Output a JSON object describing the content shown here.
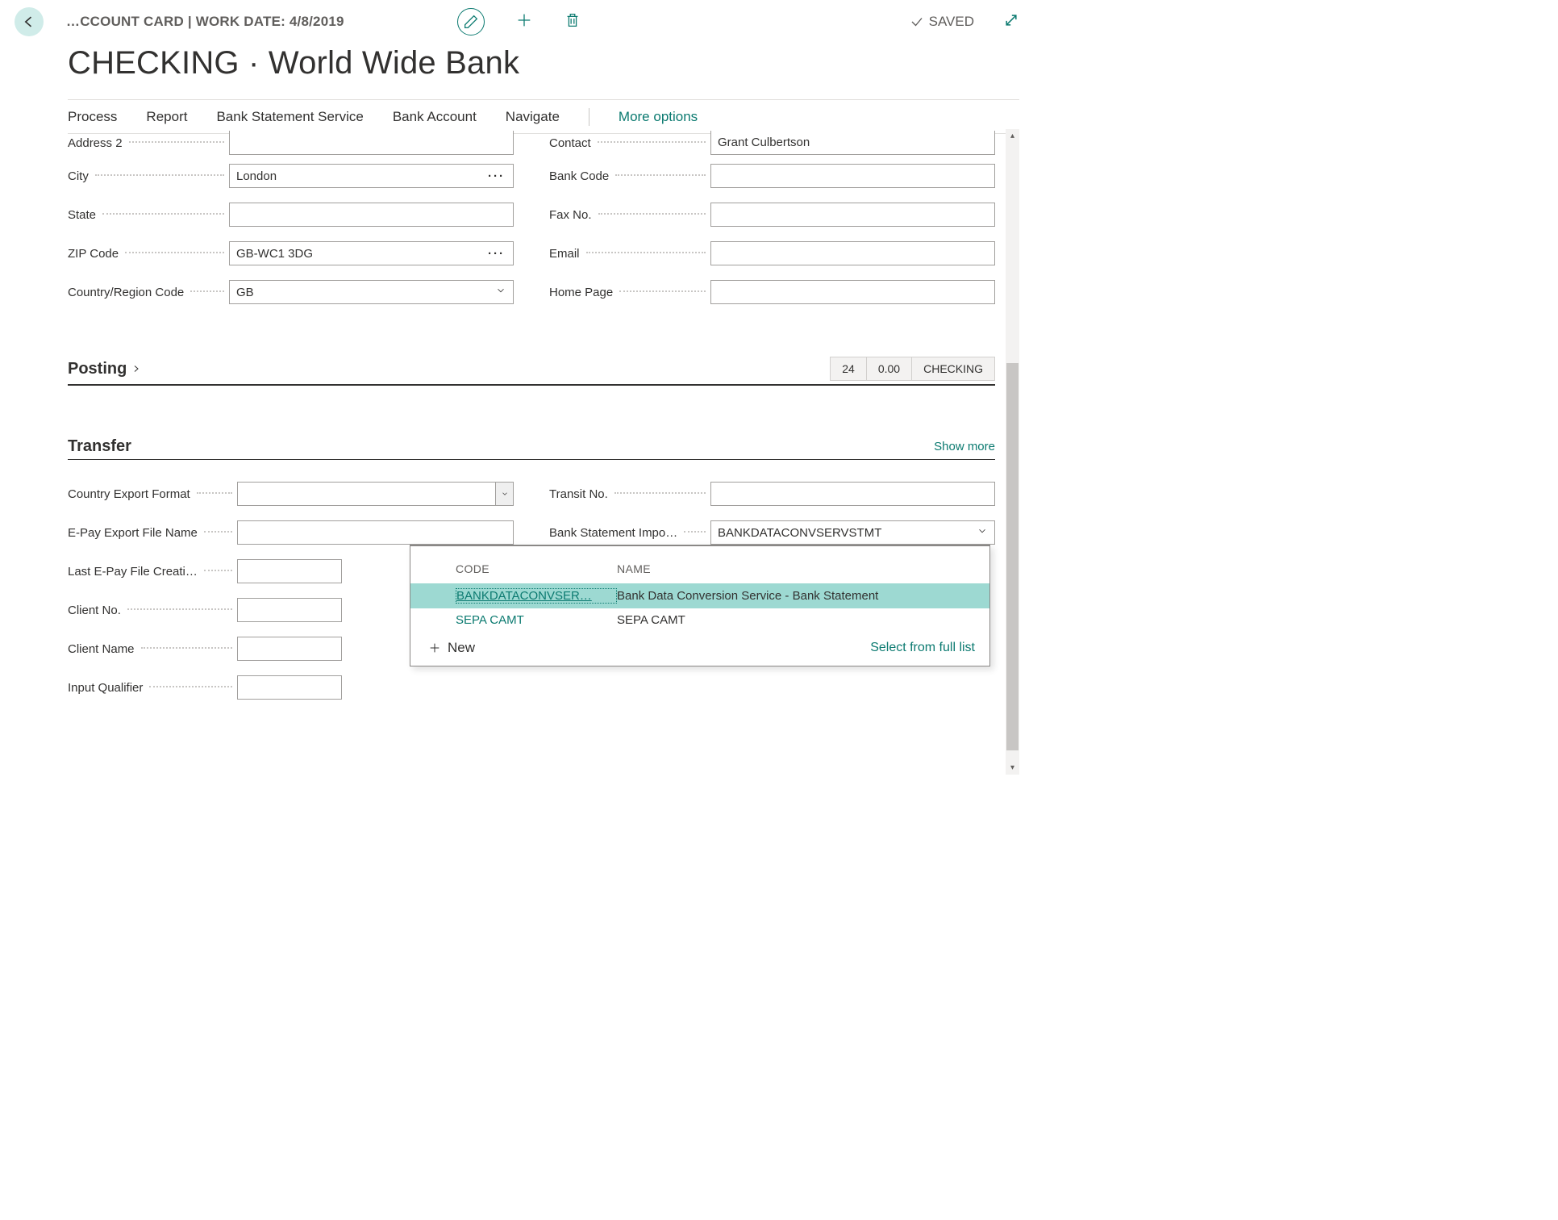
{
  "header": {
    "breadcrumb": "…CCOUNT CARD | WORK DATE: 4/8/2019",
    "saved_label": "SAVED"
  },
  "page_title": "CHECKING · World Wide Bank",
  "menu": {
    "process": "Process",
    "report": "Report",
    "bank_stmt_service": "Bank Statement Service",
    "bank_account": "Bank Account",
    "navigate": "Navigate",
    "more_options": "More options"
  },
  "fields_left": {
    "address2": {
      "label": "Address 2",
      "value": ""
    },
    "city": {
      "label": "City",
      "value": "London"
    },
    "state": {
      "label": "State",
      "value": ""
    },
    "zip": {
      "label": "ZIP Code",
      "value": "GB-WC1 3DG"
    },
    "country": {
      "label": "Country/Region Code",
      "value": "GB"
    }
  },
  "fields_right": {
    "contact": {
      "label": "Contact",
      "value": "Grant Culbertson"
    },
    "bank_code": {
      "label": "Bank Code",
      "value": ""
    },
    "fax": {
      "label": "Fax No.",
      "value": ""
    },
    "email": {
      "label": "Email",
      "value": ""
    },
    "home_page": {
      "label": "Home Page",
      "value": ""
    }
  },
  "posting": {
    "title": "Posting",
    "values": [
      "24",
      "0.00",
      "CHECKING"
    ]
  },
  "transfer": {
    "title": "Transfer",
    "show_more": "Show more",
    "left": {
      "country_export": {
        "label": "Country Export Format",
        "value": ""
      },
      "epay_export": {
        "label": "E-Pay Export File Name",
        "value": ""
      },
      "last_epay": {
        "label": "Last E-Pay File Creati…",
        "value": ""
      },
      "client_no": {
        "label": "Client No.",
        "value": ""
      },
      "client_name": {
        "label": "Client Name",
        "value": ""
      },
      "input_qualifier": {
        "label": "Input Qualifier",
        "value": ""
      }
    },
    "right": {
      "transit_no": {
        "label": "Transit No.",
        "value": ""
      },
      "bank_stmt_import": {
        "label": "Bank Statement Impo…",
        "value": "BANKDATACONVSERVSTMT"
      }
    }
  },
  "dropdown": {
    "col_code": "CODE",
    "col_name": "NAME",
    "rows": [
      {
        "code": "BANKDATACONVSER…",
        "name": "Bank Data Conversion Service - Bank Statement",
        "selected": true
      },
      {
        "code": "SEPA CAMT",
        "name": "SEPA CAMT",
        "selected": false
      }
    ],
    "new_label": "New",
    "full_list": "Select from full list"
  }
}
